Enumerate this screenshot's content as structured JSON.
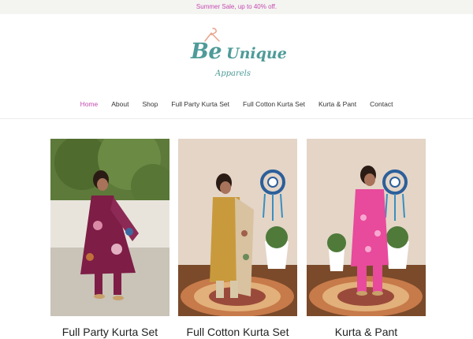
{
  "promo": {
    "text": "Summer Sale, up to 40% off."
  },
  "brand": {
    "name_be": "Be",
    "name_unique": "Unique",
    "sub": "Apparels",
    "color": "#4e9b99"
  },
  "nav": {
    "items": [
      {
        "label": "Home",
        "active": true
      },
      {
        "label": "About"
      },
      {
        "label": "Shop"
      },
      {
        "label": "Full Party Kurta Set"
      },
      {
        "label": "Full Cotton Kurta Set"
      },
      {
        "label": "Kurta & Pant"
      },
      {
        "label": "Contact"
      }
    ],
    "active_color": "#c44bb0"
  },
  "categories": [
    {
      "title": "Full Party Kurta Set",
      "image": "woman in maroon floral kurta with dupatta, outdoor terrace, tree"
    },
    {
      "title": "Full Cotton Kurta Set",
      "image": "woman in mustard kurta with printed dupatta, indoor, wall hanging"
    },
    {
      "title": "Kurta & Pant",
      "image": "woman in pink kurta and pants, indoor, wall hanging"
    }
  ]
}
